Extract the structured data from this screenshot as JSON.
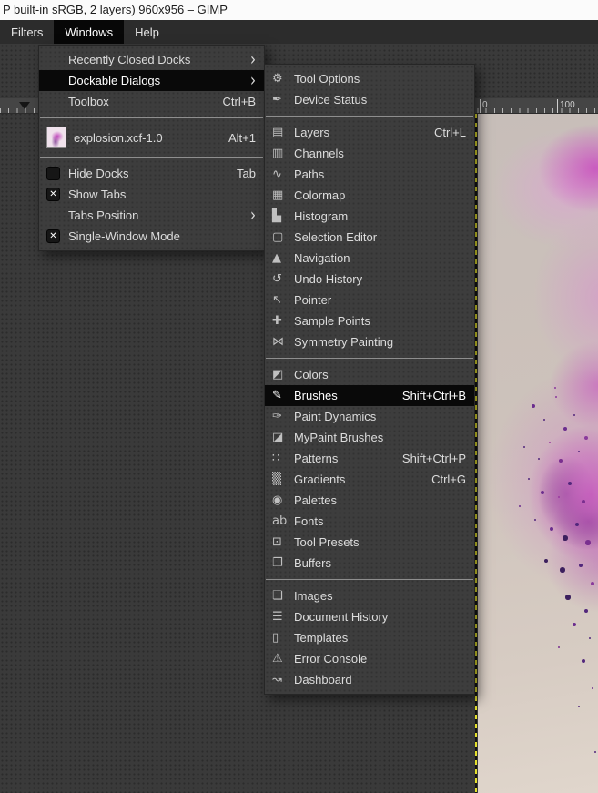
{
  "window": {
    "title": "P built-in sRGB, 2 layers) 960x956 – GIMP"
  },
  "menubar": {
    "items": [
      {
        "label": "Filters",
        "active": false
      },
      {
        "label": "Windows",
        "active": true
      },
      {
        "label": "Help",
        "active": false
      }
    ]
  },
  "windows_menu": {
    "items": [
      {
        "label": "Recently Closed Docks",
        "submenu": true
      },
      {
        "label": "Dockable Dialogs",
        "submenu": true,
        "highlighted": true
      },
      {
        "label": "Toolbox",
        "shortcut": "Ctrl+B"
      },
      {
        "separator": true
      },
      {
        "label": "explosion.xcf-1.0",
        "shortcut": "Alt+1",
        "thumbnail": true
      },
      {
        "separator": true
      },
      {
        "label": "Hide Docks",
        "shortcut": "Tab",
        "checkbox": "unchecked"
      },
      {
        "label": "Show Tabs",
        "checkbox": "checked"
      },
      {
        "label": "Tabs Position",
        "submenu": true
      },
      {
        "label": "Single-Window Mode",
        "checkbox": "checked"
      }
    ]
  },
  "dockable_dialogs_menu": {
    "items": [
      {
        "label": "Tool Options",
        "icon": "tool-options-icon",
        "glyph": "⚙"
      },
      {
        "label": "Device Status",
        "icon": "device-status-icon",
        "glyph": "✒"
      },
      {
        "separator": true
      },
      {
        "label": "Layers",
        "shortcut": "Ctrl+L",
        "icon": "layers-icon",
        "glyph": "▤"
      },
      {
        "label": "Channels",
        "icon": "channels-icon",
        "glyph": "▥"
      },
      {
        "label": "Paths",
        "icon": "paths-icon",
        "glyph": "∿"
      },
      {
        "label": "Colormap",
        "icon": "colormap-icon",
        "glyph": "▦"
      },
      {
        "label": "Histogram",
        "icon": "histogram-icon",
        "glyph": "▙"
      },
      {
        "label": "Selection Editor",
        "icon": "selection-editor-icon",
        "glyph": "▢"
      },
      {
        "label": "Navigation",
        "icon": "navigation-icon",
        "glyph": "▲"
      },
      {
        "label": "Undo History",
        "icon": "undo-history-icon",
        "glyph": "↺"
      },
      {
        "label": "Pointer",
        "icon": "pointer-icon",
        "glyph": "↖"
      },
      {
        "label": "Sample Points",
        "icon": "sample-points-icon",
        "glyph": "✚"
      },
      {
        "label": "Symmetry Painting",
        "icon": "symmetry-painting-icon",
        "glyph": "⋈"
      },
      {
        "separator": true
      },
      {
        "label": "Colors",
        "icon": "colors-icon",
        "glyph": "◩"
      },
      {
        "label": "Brushes",
        "shortcut": "Shift+Ctrl+B",
        "icon": "brushes-icon",
        "glyph": "✎",
        "highlighted": true
      },
      {
        "label": "Paint Dynamics",
        "icon": "paint-dynamics-icon",
        "glyph": "✑"
      },
      {
        "label": "MyPaint Brushes",
        "icon": "mypaint-brushes-icon",
        "glyph": "◪"
      },
      {
        "label": "Patterns",
        "shortcut": "Shift+Ctrl+P",
        "icon": "patterns-icon",
        "glyph": "∷"
      },
      {
        "label": "Gradients",
        "shortcut": "Ctrl+G",
        "icon": "gradients-icon",
        "glyph": "▒"
      },
      {
        "label": "Palettes",
        "icon": "palettes-icon",
        "glyph": "◉"
      },
      {
        "label": "Fonts",
        "icon": "fonts-icon",
        "glyph": "ab"
      },
      {
        "label": "Tool Presets",
        "icon": "tool-presets-icon",
        "glyph": "⊡"
      },
      {
        "label": "Buffers",
        "icon": "buffers-icon",
        "glyph": "❐"
      },
      {
        "separator": true
      },
      {
        "label": "Images",
        "icon": "images-icon",
        "glyph": "❏"
      },
      {
        "label": "Document History",
        "icon": "document-history-icon",
        "glyph": "☰"
      },
      {
        "label": "Templates",
        "icon": "templates-icon",
        "glyph": "▯"
      },
      {
        "label": "Error Console",
        "icon": "error-console-icon",
        "glyph": "⚠"
      },
      {
        "label": "Dashboard",
        "icon": "dashboard-icon",
        "glyph": "↝"
      }
    ]
  },
  "ruler": {
    "zero_label": "0",
    "hundred_label": "100"
  },
  "colors": {
    "menu_highlight": "#090909",
    "menu_background": "#3d3d3d",
    "layer_boundary_yellow": "#e3df2b",
    "explosion_magenta": "#ba34b2",
    "explosion_dark_purple": "#3c1f5e",
    "canvas_beige": "#cdc3bc"
  }
}
